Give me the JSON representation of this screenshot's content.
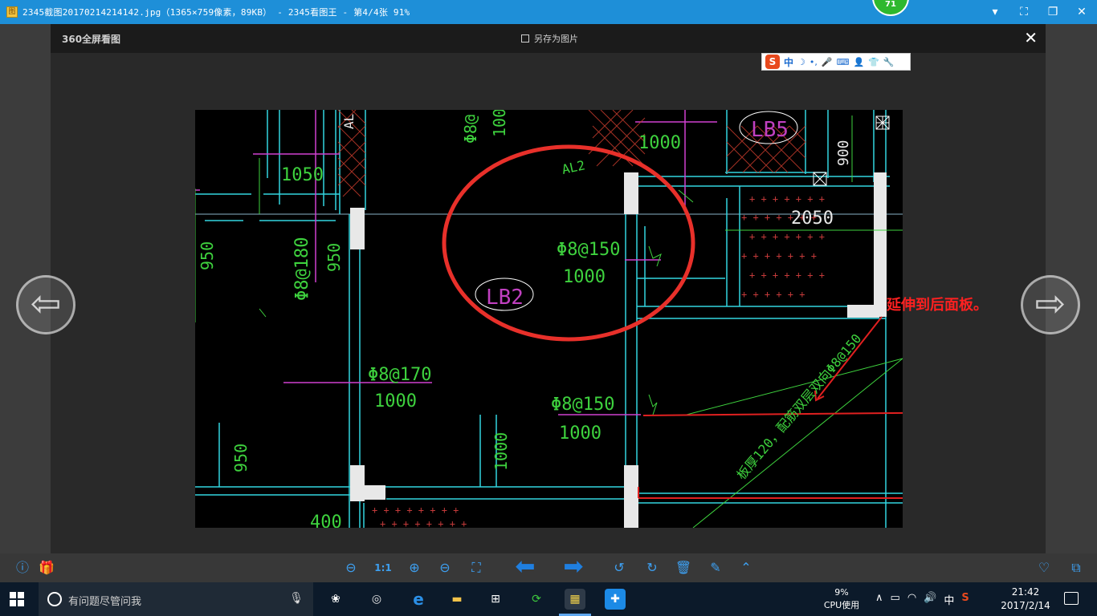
{
  "window": {
    "title": "2345截图20170214214142.jpg（1365×759像素，89KB） - 2345看图王 - 第4/4张 91%",
    "notify_badge": "71",
    "controls": [
      "▾",
      "⛶",
      "❐",
      "✕"
    ]
  },
  "viewer": {
    "brand": "360全屏看图",
    "save_as": "另存为图片",
    "close": "✕"
  },
  "ime": {
    "logo": "S",
    "mode": "中",
    "icons": [
      "☽",
      "•,",
      "🎤",
      "⌨",
      "👤",
      "👕",
      "🔧"
    ]
  },
  "cad": {
    "labels": {
      "lb5": "LB5",
      "lb2": "LB2",
      "al_top": "AL",
      "al2": "AL2",
      "d1050": "1050",
      "d1000_top": "1000",
      "d1000_rotated_top": "1000",
      "d900": "900",
      "d2050": "2050",
      "phi8_150_a": "Φ8@150",
      "d1000_a": "1000",
      "phi8_180": "Φ8@180",
      "d950_left": "950",
      "d950_mid": "950",
      "phi8_top": "Φ8@",
      "phi8_170": "Φ8@170",
      "d1000_b": "1000",
      "phi8_150_b": "Φ8@150",
      "d1000_c": "1000",
      "d950_bottom": "950",
      "d1000_vert_bottom": "1000",
      "d400": "400",
      "slab_note": "板厚120，配筋双层双向Φ8@150"
    }
  },
  "annotation": {
    "text": "延伸到后面板。"
  },
  "nav": {
    "prev": "⇦",
    "next": "⇨"
  },
  "toolbar": {
    "info": "ⓘ",
    "gift": "🎁",
    "fit": "⊖",
    "actual": "1:1",
    "zoom_in": "⊕",
    "zoom_out": "⊖",
    "fullscreen": "⛶",
    "prev": "⬅",
    "next": "➡",
    "rotate_left": "↺",
    "rotate_right": "↻",
    "delete": "🗑",
    "edit": "✎",
    "more": "⌃",
    "favorite": "♡",
    "share": "⧉"
  },
  "taskbar": {
    "search_placeholder": "有问题尽管问我",
    "mic": "🎙",
    "apps": [
      "❀",
      "◎",
      "e",
      "▬",
      "⊞",
      "⟳",
      "▦",
      "✚"
    ],
    "cpu_percent": "9%",
    "cpu_label": "CPU使用",
    "tray": [
      "∧",
      "▭",
      "◠",
      "🔊",
      "中",
      "S"
    ],
    "time": "21:42",
    "date": "2017/2/14"
  }
}
